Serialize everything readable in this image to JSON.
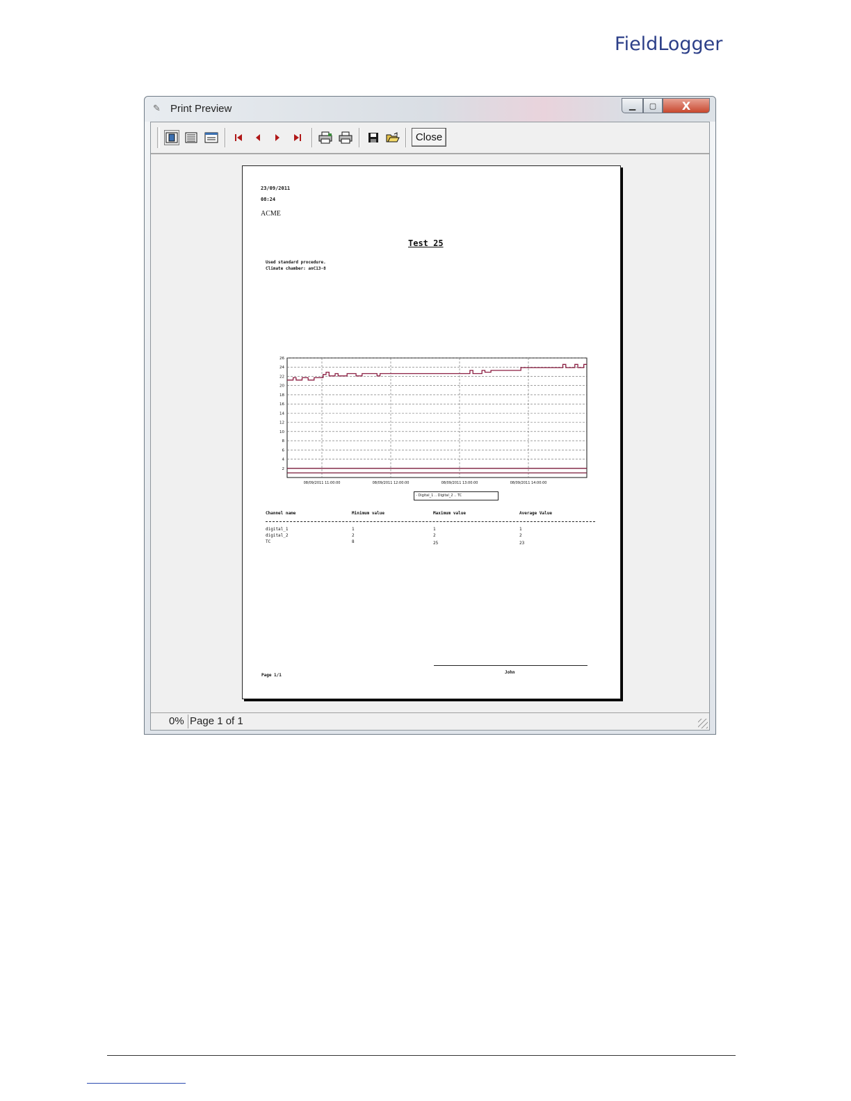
{
  "brand": {
    "logo_text": "FieldLogger",
    "color": "#2c3f88"
  },
  "window": {
    "title": "Print Preview",
    "controls": {
      "minimize": "▁",
      "maximize": "▢",
      "close": "X"
    }
  },
  "toolbar": {
    "icons": [
      "one-page-icon",
      "page-width-icon",
      "zoom-icon",
      "first-page-icon",
      "previous-page-icon",
      "next-page-icon",
      "last-page-icon",
      "print-setup-icon",
      "print-icon",
      "save-icon",
      "open-icon"
    ],
    "close_label": "Close"
  },
  "report": {
    "date": "23/09/2011",
    "time": "08:24",
    "company": "ACME",
    "title": "Test 25",
    "description_line1": "Used standard procedure.",
    "description_line2": "Climate chamber: anC13-8",
    "legend": "- Digital_1 .. Digital_2 .. TC",
    "table": {
      "headers": [
        "Channel name",
        "Minimum value",
        "Maximum value",
        "Average Value"
      ],
      "rows": [
        [
          "digital_1",
          "1",
          "1",
          "1"
        ],
        [
          "digital_2",
          "2",
          "2",
          "2"
        ],
        [
          "TC",
          "8",
          "25",
          "23"
        ]
      ]
    },
    "signature": "John",
    "page_label": "Page 1/1"
  },
  "chart_data": {
    "type": "line",
    "y_ticks": [
      "26",
      "24",
      "22",
      "20",
      "18",
      "16",
      "14",
      "12",
      "10",
      "8",
      "6",
      "4",
      "2"
    ],
    "x_ticks": [
      "08/09/2011 11:00:00",
      "08/09/2011 12:00:00",
      "08/09/2011 13:00:00",
      "08/09/2011 14:00:00"
    ],
    "ylim": [
      0,
      26
    ],
    "grid": true,
    "series": [
      {
        "name": "Digital_1",
        "color": "#7a1a3a",
        "points": [
          [
            0,
            1
          ],
          [
            1,
            1
          ]
        ]
      },
      {
        "name": "Digital_2",
        "color": "#7a1a3a",
        "points": [
          [
            0,
            2
          ],
          [
            1,
            2
          ]
        ]
      },
      {
        "name": "TC",
        "color": "#8b1e42",
        "points": [
          [
            0.0,
            21.2
          ],
          [
            0.02,
            21.2
          ],
          [
            0.02,
            21.7
          ],
          [
            0.03,
            21.7
          ],
          [
            0.03,
            21.2
          ],
          [
            0.05,
            21.2
          ],
          [
            0.05,
            21.7
          ],
          [
            0.07,
            21.7
          ],
          [
            0.07,
            21.2
          ],
          [
            0.09,
            21.2
          ],
          [
            0.09,
            21.7
          ],
          [
            0.12,
            21.7
          ],
          [
            0.12,
            22.4
          ],
          [
            0.13,
            22.4
          ],
          [
            0.13,
            22.9
          ],
          [
            0.14,
            22.9
          ],
          [
            0.14,
            22.1
          ],
          [
            0.16,
            22.1
          ],
          [
            0.16,
            22.6
          ],
          [
            0.17,
            22.6
          ],
          [
            0.17,
            22.1
          ],
          [
            0.2,
            22.1
          ],
          [
            0.2,
            22.6
          ],
          [
            0.23,
            22.6
          ],
          [
            0.23,
            22.1
          ],
          [
            0.25,
            22.1
          ],
          [
            0.25,
            22.6
          ],
          [
            0.3,
            22.6
          ],
          [
            0.3,
            22.1
          ],
          [
            0.31,
            22.1
          ],
          [
            0.31,
            22.6
          ],
          [
            0.61,
            22.6
          ],
          [
            0.61,
            23.3
          ],
          [
            0.62,
            23.3
          ],
          [
            0.62,
            22.6
          ],
          [
            0.65,
            22.6
          ],
          [
            0.65,
            23.3
          ],
          [
            0.66,
            23.3
          ],
          [
            0.66,
            22.9
          ],
          [
            0.68,
            22.9
          ],
          [
            0.68,
            23.3
          ],
          [
            0.78,
            23.3
          ],
          [
            0.78,
            23.9
          ],
          [
            0.92,
            23.9
          ],
          [
            0.92,
            24.6
          ],
          [
            0.93,
            24.6
          ],
          [
            0.93,
            23.9
          ],
          [
            0.96,
            23.9
          ],
          [
            0.96,
            24.6
          ],
          [
            0.97,
            24.6
          ],
          [
            0.97,
            23.9
          ],
          [
            0.99,
            23.9
          ],
          [
            0.99,
            24.6
          ],
          [
            1.0,
            24.6
          ]
        ]
      }
    ],
    "legend_entries": [
      "Digital_1",
      "Digital_2",
      "TC"
    ]
  }
}
